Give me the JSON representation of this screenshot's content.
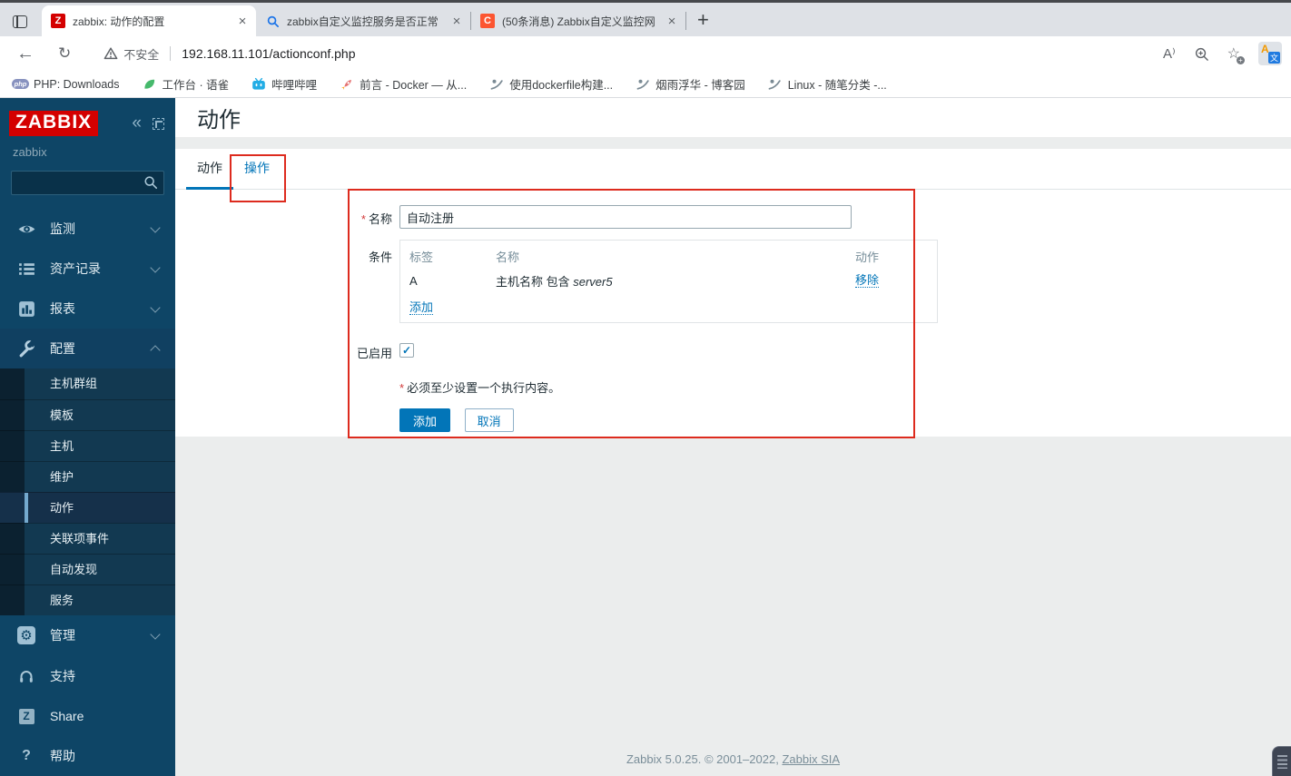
{
  "browser": {
    "tabs": [
      {
        "title": "zabbix: 动作的配置",
        "favicon_letter": "Z",
        "favicon_bg": "#d40000",
        "active": true
      },
      {
        "title": "zabbix自定义监控服务是否正常",
        "favicon_letter": "",
        "active": false
      },
      {
        "title": "(50条消息) Zabbix自定义监控网",
        "favicon_letter": "C",
        "favicon_bg": "#fc5531",
        "active": false
      }
    ],
    "new_tab_glyph": "+",
    "close_glyph": "×",
    "back_glyph": "←",
    "refresh_glyph": "↻",
    "security_label": "不安全",
    "url": "192.168.11.101/actionconf.php",
    "read_aloud_glyph": "A⁾",
    "star_glyph": "☆",
    "star_plus_glyph": "+",
    "translate_a": "A",
    "translate_cn": "文",
    "bookmarks": [
      {
        "label": "PHP: Downloads",
        "icon": "php-icon",
        "badge": "php"
      },
      {
        "label": "工作台 · 语雀",
        "icon": "yuque-leaf-icon"
      },
      {
        "label": "哔哩哔哩",
        "icon": "bilibili-icon"
      },
      {
        "label": "前言 - Docker — 从...",
        "icon": "rocket-icon"
      },
      {
        "label": "使用dockerfile构建...",
        "icon": "blog-icon"
      },
      {
        "label": "烟雨浮华 - 博客园",
        "icon": "blog-icon"
      },
      {
        "label": "Linux - 随笔分类 -...",
        "icon": "blog-icon"
      }
    ]
  },
  "sidebar": {
    "logo": "ZABBIX",
    "collapse_glyph": "«",
    "server_name": "zabbix",
    "menu": [
      {
        "label": "监测",
        "icon": "eye-icon",
        "state": "collapsed"
      },
      {
        "label": "资产记录",
        "icon": "list-icon",
        "state": "collapsed"
      },
      {
        "label": "报表",
        "icon": "chart-icon",
        "state": "collapsed"
      },
      {
        "label": "配置",
        "icon": "wrench-icon",
        "state": "expanded",
        "children": [
          "主机群组",
          "模板",
          "主机",
          "维护",
          "动作",
          "关联项事件",
          "自动发现",
          "服务"
        ],
        "selected_child": "动作"
      },
      {
        "label": "管理",
        "icon": "gear-icon",
        "state": "collapsed",
        "gear_glyph": "⚙"
      }
    ],
    "footer_menu": [
      {
        "label": "支持",
        "icon": "headset-icon"
      },
      {
        "label": "Share",
        "icon": "zabbix-share-icon",
        "glyph": "Z"
      },
      {
        "label": "帮助",
        "icon": "question-icon",
        "glyph": "?"
      }
    ]
  },
  "page": {
    "title": "动作",
    "tabs": [
      {
        "label": "动作",
        "active": true
      },
      {
        "label": "操作",
        "active": false
      }
    ],
    "form": {
      "required_mark": "*",
      "name_label": "名称",
      "name_value": "自动注册",
      "conditions_label": "条件",
      "conditions_table": {
        "headers": [
          "标签",
          "名称",
          "动作"
        ],
        "rows": [
          {
            "tag": "A",
            "name_prefix": "主机名称 包含 ",
            "name_value": "server5",
            "action": "移除"
          }
        ],
        "add_label": "添加"
      },
      "enabled_label": "已启用",
      "enabled_checked": "true",
      "required_message": "必须至少设置一个执行内容。",
      "submit_label": "添加",
      "cancel_label": "取消"
    },
    "footer_text": "Zabbix 5.0.25. © 2001–2022, ",
    "footer_link": "Zabbix SIA"
  },
  "colors": {
    "accent_blue": "#0275b8",
    "annotation_red": "#dd2b1e",
    "logo_red": "#d40000",
    "sidebar_bg": "#0e4566"
  }
}
